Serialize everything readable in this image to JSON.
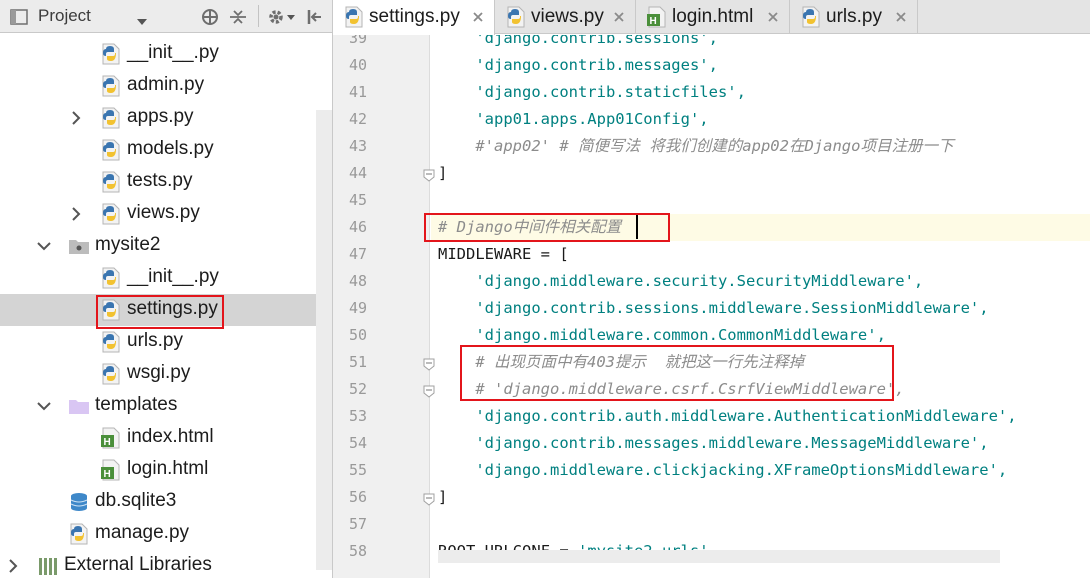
{
  "project": {
    "title": "Project",
    "tree": [
      {
        "label": "__init__.py",
        "icon": "python-file-icon",
        "indent": 1,
        "arrow": "none"
      },
      {
        "label": "admin.py",
        "icon": "python-file-icon",
        "indent": 1,
        "arrow": "none"
      },
      {
        "label": "apps.py",
        "icon": "python-file-icon",
        "indent": 1,
        "arrow": "right"
      },
      {
        "label": "models.py",
        "icon": "python-file-icon",
        "indent": 1,
        "arrow": "none"
      },
      {
        "label": "tests.py",
        "icon": "python-file-icon",
        "indent": 1,
        "arrow": "none"
      },
      {
        "label": "views.py",
        "icon": "python-file-icon",
        "indent": 1,
        "arrow": "right"
      },
      {
        "label": "mysite2",
        "icon": "package-folder-icon",
        "indent": 0,
        "arrow": "down"
      },
      {
        "label": "__init__.py",
        "icon": "python-file-icon",
        "indent": 1,
        "arrow": "none"
      },
      {
        "label": "settings.py",
        "icon": "python-file-icon",
        "indent": 1,
        "arrow": "none",
        "selected": true
      },
      {
        "label": "urls.py",
        "icon": "python-file-icon",
        "indent": 1,
        "arrow": "none"
      },
      {
        "label": "wsgi.py",
        "icon": "python-file-icon",
        "indent": 1,
        "arrow": "none"
      },
      {
        "label": "templates",
        "icon": "folder-icon",
        "indent": 0,
        "arrow": "down"
      },
      {
        "label": "index.html",
        "icon": "html-file-icon",
        "indent": 1,
        "arrow": "none"
      },
      {
        "label": "login.html",
        "icon": "html-file-icon",
        "indent": 1,
        "arrow": "none"
      },
      {
        "label": "db.sqlite3",
        "icon": "database-icon",
        "indent": 0,
        "arrow": "none"
      },
      {
        "label": "manage.py",
        "icon": "python-file-icon",
        "indent": 0,
        "arrow": "none"
      },
      {
        "label": "External Libraries",
        "icon": "library-icon",
        "indent": -1,
        "arrow": "right"
      }
    ]
  },
  "tabs": [
    {
      "label": "settings.py",
      "icon": "python-file-icon",
      "active": true
    },
    {
      "label": "views.py",
      "icon": "python-file-icon",
      "active": false
    },
    {
      "label": "login.html",
      "icon": "html-file-icon",
      "active": false
    },
    {
      "label": "urls.py",
      "icon": "python-file-icon",
      "active": false
    }
  ],
  "editor": {
    "current_line": 46,
    "lines": [
      {
        "n": "39",
        "tokens": [
          {
            "t": "    'django.contrib.sessions',",
            "c": "str"
          }
        ]
      },
      {
        "n": "40",
        "tokens": [
          {
            "t": "    'django.contrib.messages',",
            "c": "str"
          }
        ]
      },
      {
        "n": "41",
        "tokens": [
          {
            "t": "    'django.contrib.staticfiles',",
            "c": "str"
          }
        ]
      },
      {
        "n": "42",
        "tokens": [
          {
            "t": "    'app01.apps.App01Config',",
            "c": "str"
          }
        ]
      },
      {
        "n": "43",
        "tokens": [
          {
            "t": "    #'app02' # 简便写法 将我们创建的app02在Django项目注册一下",
            "c": "comment"
          }
        ]
      },
      {
        "n": "44",
        "tokens": [
          {
            "t": "]",
            "c": "plain"
          }
        ]
      },
      {
        "n": "45",
        "tokens": [
          {
            "t": "",
            "c": "plain"
          }
        ]
      },
      {
        "n": "46",
        "tokens": [
          {
            "t": "# Django中间件相关配置",
            "c": "comment"
          }
        ]
      },
      {
        "n": "47",
        "tokens": [
          {
            "t": "MIDDLEWARE = [",
            "c": "plain"
          }
        ]
      },
      {
        "n": "48",
        "tokens": [
          {
            "t": "    'django.middleware.security.SecurityMiddleware',",
            "c": "str"
          }
        ]
      },
      {
        "n": "49",
        "tokens": [
          {
            "t": "    'django.contrib.sessions.middleware.SessionMiddleware',",
            "c": "str"
          }
        ]
      },
      {
        "n": "50",
        "tokens": [
          {
            "t": "    'django.middleware.common.CommonMiddleware',",
            "c": "str"
          }
        ]
      },
      {
        "n": "51",
        "tokens": [
          {
            "t": "    # 出现页面中有403提示  就把这一行先注释掉",
            "c": "comment"
          }
        ]
      },
      {
        "n": "52",
        "tokens": [
          {
            "t": "    # 'django.middleware.csrf.CsrfViewMiddleware',",
            "c": "comment"
          }
        ]
      },
      {
        "n": "53",
        "tokens": [
          {
            "t": "    'django.contrib.auth.middleware.AuthenticationMiddleware',",
            "c": "str"
          }
        ]
      },
      {
        "n": "54",
        "tokens": [
          {
            "t": "    'django.contrib.messages.middleware.MessageMiddleware',",
            "c": "str"
          }
        ]
      },
      {
        "n": "55",
        "tokens": [
          {
            "t": "    'django.middleware.clickjacking.XFrameOptionsMiddleware',",
            "c": "str"
          }
        ]
      },
      {
        "n": "56",
        "tokens": [
          {
            "t": "]",
            "c": "plain"
          }
        ]
      },
      {
        "n": "57",
        "tokens": [
          {
            "t": "",
            "c": "plain"
          }
        ]
      },
      {
        "n": "58",
        "tokens": [
          {
            "t": "ROOT_URLCONF = ",
            "c": "plain"
          },
          {
            "t": "'mysite2.urls'",
            "c": "str"
          }
        ]
      }
    ]
  },
  "colors": {
    "highlight_box": "#e3151b",
    "string": "#008080",
    "comment": "#8c8c8c"
  }
}
